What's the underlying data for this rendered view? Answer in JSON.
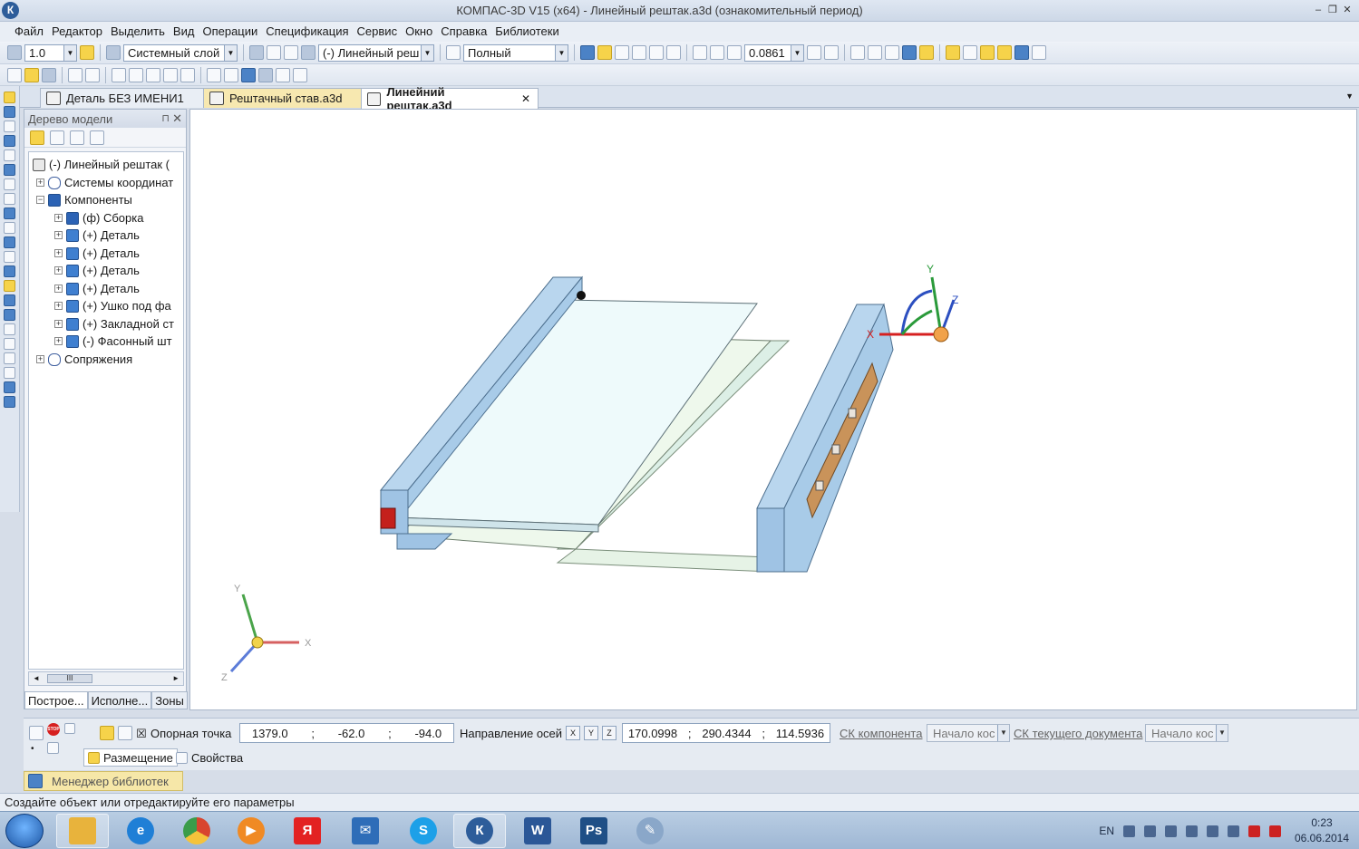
{
  "window": {
    "title": "КОМПАС-3D V15 (x64) - Линейный рештак.a3d (ознакомительный период)",
    "app_icon": "К"
  },
  "menu": [
    "Файл",
    "Редактор",
    "Выделить",
    "Вид",
    "Операции",
    "Спецификация",
    "Сервис",
    "Окно",
    "Справка",
    "Библиотеки"
  ],
  "toolbar1": {
    "step_value": "1.0",
    "layer": "Системный слой",
    "component": "(-) Линейный реш",
    "display_mode": "Полный",
    "zoom": "0.0861"
  },
  "tabs": [
    {
      "label": "Деталь БЕЗ ИМЕНИ1",
      "state": "normal"
    },
    {
      "label": "Рештачный став.a3d",
      "state": "highlight"
    },
    {
      "label": "Линейний рештак.a3d",
      "state": "active",
      "close": "✕"
    }
  ],
  "tree": {
    "header": "Дерево модели",
    "pin": "⊓",
    "close": "✕",
    "nodes": [
      {
        "label": "(-) Линейный рештак (",
        "level": 0,
        "toggle": "",
        "icon": "root"
      },
      {
        "label": "Системы координат",
        "level": 1,
        "toggle": "+",
        "icon": "link"
      },
      {
        "label": "Компоненты",
        "level": 1,
        "toggle": "−",
        "icon": "asm"
      },
      {
        "label": "(ф) Сборка",
        "level": 2,
        "toggle": "+",
        "icon": "asm"
      },
      {
        "label": "(+) Деталь",
        "level": 2,
        "toggle": "+",
        "icon": "part"
      },
      {
        "label": "(+) Деталь",
        "level": 2,
        "toggle": "+",
        "icon": "part"
      },
      {
        "label": "(+) Деталь",
        "level": 2,
        "toggle": "+",
        "icon": "part"
      },
      {
        "label": "(+) Деталь",
        "level": 2,
        "toggle": "+",
        "icon": "part"
      },
      {
        "label": "(+) Ушко под фа",
        "level": 2,
        "toggle": "+",
        "icon": "part"
      },
      {
        "label": "(+) Закладной ст",
        "level": 2,
        "toggle": "+",
        "icon": "part"
      },
      {
        "label": "(-) Фасонный шт",
        "level": 2,
        "toggle": "+",
        "icon": "part"
      },
      {
        "label": "Сопряжения",
        "level": 1,
        "toggle": "+",
        "icon": "link"
      }
    ],
    "scroll_thumb": "III",
    "bottom_tabs": [
      "Построе...",
      "Исполне...",
      "Зоны"
    ]
  },
  "axes": {
    "x": "X",
    "y": "Y",
    "z": "Z"
  },
  "props": {
    "anchor_label": "Опорная точка",
    "anchor": {
      "x": "1379.0",
      "y": "-62.0",
      "z": "-94.0"
    },
    "axis_dir_label": "Направление осей",
    "axis_buttons": [
      "X",
      "Y",
      "Z"
    ],
    "axis_dir": {
      "x": "170.0998",
      "y": "290.4344",
      "z": "114.5936"
    },
    "sep": ";",
    "component_cs_label": "СК компонента",
    "component_cs_value": "Начало кос",
    "doc_cs_label": "СК текущего документа",
    "doc_cs_value": "Начало кос",
    "tab_place": "Размещение",
    "tab_props": "Свойства",
    "stop": "STOP"
  },
  "library_manager": "Менеджер библиотек",
  "status": "Создайте объект или отредактируйте его параметры",
  "taskbar": {
    "apps": [
      {
        "name": "explorer",
        "glyph": "",
        "color": "#e8b33c"
      },
      {
        "name": "ie",
        "glyph": "e",
        "color": "#1f7fd6"
      },
      {
        "name": "chrome",
        "glyph": "",
        "color": "#d8452f"
      },
      {
        "name": "media",
        "glyph": "▶",
        "color": "#f08a24"
      },
      {
        "name": "yandex",
        "glyph": "Я",
        "color": "#e32222"
      },
      {
        "name": "mail",
        "glyph": "✉",
        "color": "#2e6db8"
      },
      {
        "name": "skype",
        "glyph": "S",
        "color": "#1da0e8"
      },
      {
        "name": "kompas",
        "glyph": "К",
        "color": "#2d5d9a"
      },
      {
        "name": "word",
        "glyph": "W",
        "color": "#2b5797"
      },
      {
        "name": "photoshop",
        "glyph": "Ps",
        "color": "#1f4f86"
      },
      {
        "name": "paint",
        "glyph": "✎",
        "color": "#8aa7c9"
      }
    ],
    "lang": "EN",
    "time": "0:23",
    "date": "06.06.2014"
  }
}
